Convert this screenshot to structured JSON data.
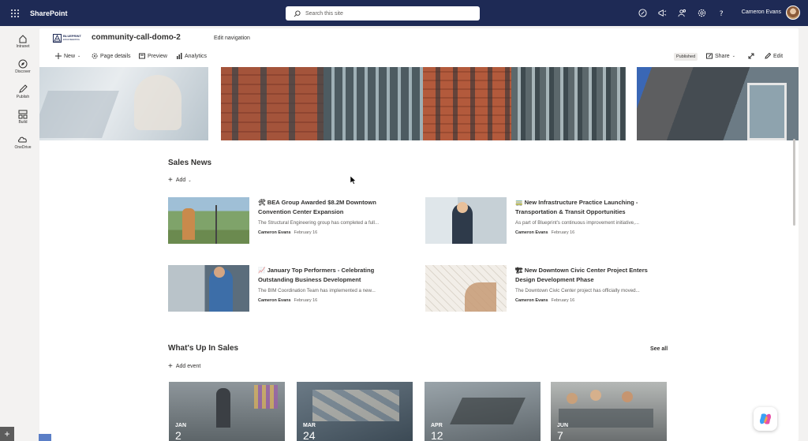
{
  "suitebar": {
    "app_name": "SharePoint",
    "search_placeholder": "Search this site",
    "user_name": "Cameron Evans",
    "icons": [
      "help-circle-icon",
      "megaphone-icon",
      "people-icon",
      "gear-icon",
      "question-icon"
    ]
  },
  "appbar": {
    "items": [
      {
        "label": "Intranet",
        "icon": "home-icon"
      },
      {
        "label": "Discover",
        "icon": "compass-icon"
      },
      {
        "label": "Publish",
        "icon": "pen-icon"
      },
      {
        "label": "Build",
        "icon": "grid-icon"
      },
      {
        "label": "OneDrive",
        "icon": "cloud-icon"
      }
    ]
  },
  "site": {
    "logo_text_1": "BLUEPRINT",
    "logo_text_2": "ENGINEERING",
    "title": "community-call-domo-2",
    "edit_navigation": "Edit navigation"
  },
  "commandbar": {
    "new": "New",
    "page_details": "Page details",
    "preview": "Preview",
    "analytics": "Analytics",
    "status": "Published",
    "share": "Share",
    "edit": "Edit"
  },
  "sales_news": {
    "title": "Sales News",
    "add": "Add",
    "items": [
      {
        "title": "🛠 BEA Group Awarded $8.2M Downtown Convention Center Expansion",
        "desc": "The Structural Engineering group has completed a full...",
        "author": "Cameron Evans",
        "date": "February 16"
      },
      {
        "title": "🚃 New Infrastructure Practice Launching - Transportation & Transit Opportunities",
        "desc": "As part of Blueprint's continuous improvement initiative,...",
        "author": "Cameron Evans",
        "date": "February 16"
      },
      {
        "title": "📈 January Top Performers - Celebrating Outstanding Business Development",
        "desc": "The BIM Coordination Team has implemented a new...",
        "author": "Cameron Evans",
        "date": "February 16"
      },
      {
        "title": "🏗 New Downtown Civic Center Project Enters Design Development Phase",
        "desc": "The Downtown Civic Center project has officially moved...",
        "author": "Cameron Evans",
        "date": "February 16"
      }
    ]
  },
  "events": {
    "title": "What's Up In Sales",
    "see_all": "See all",
    "add_event": "Add event",
    "items": [
      {
        "month": "JAN",
        "day": "2"
      },
      {
        "month": "MAR",
        "day": "24"
      },
      {
        "month": "APR",
        "day": "12"
      },
      {
        "month": "JUN",
        "day": "7"
      }
    ]
  }
}
